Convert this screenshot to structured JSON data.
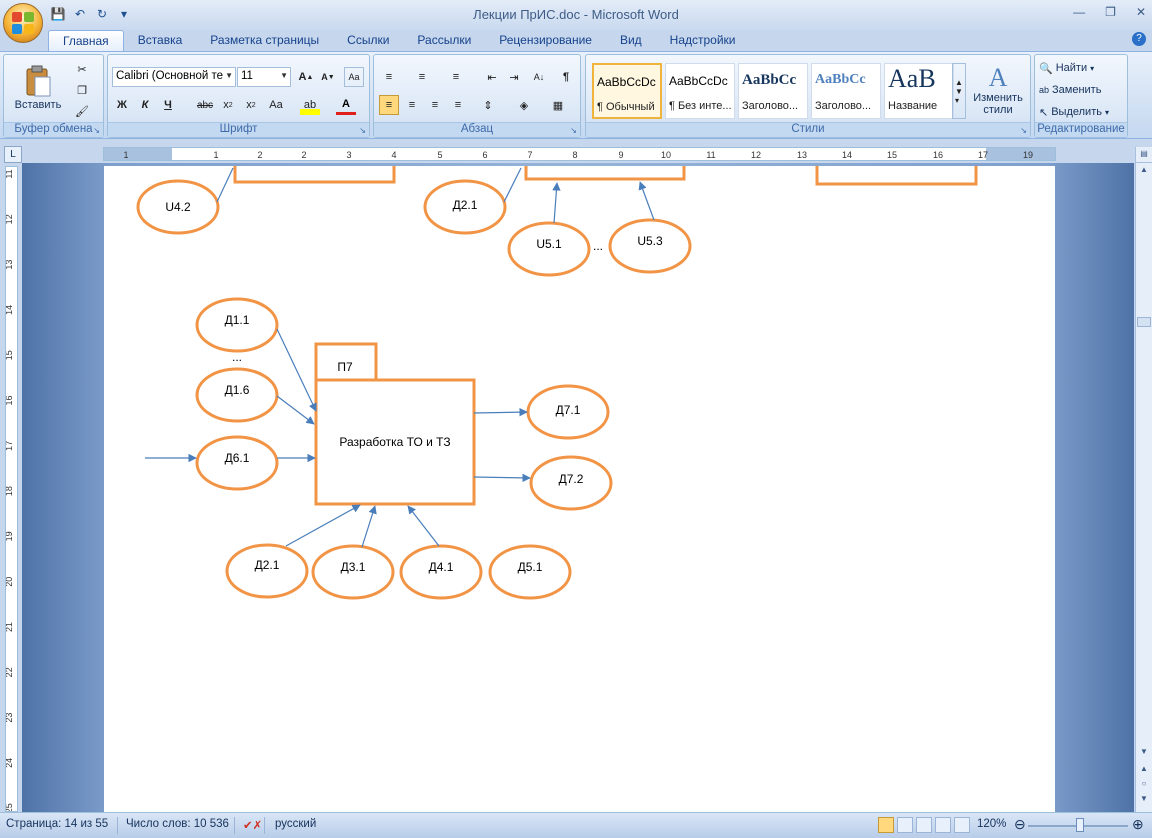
{
  "window": {
    "title": "Лекции ПрИС.doc - Microsoft Word"
  },
  "tabs": [
    "Главная",
    "Вставка",
    "Разметка страницы",
    "Ссылки",
    "Рассылки",
    "Рецензирование",
    "Вид",
    "Надстройки"
  ],
  "ribbon": {
    "clipboard": {
      "label": "Буфер обмена",
      "paste": "Вставить"
    },
    "font": {
      "label": "Шрифт",
      "font_name": "Calibri (Основной те",
      "font_size": "11"
    },
    "paragraph": {
      "label": "Абзац"
    },
    "styles": {
      "label": "Стили",
      "items": [
        {
          "sample": "AaBbCcDc",
          "name": "¶ Обычный"
        },
        {
          "sample": "AaBbCcDc",
          "name": "¶ Без инте..."
        },
        {
          "sample": "AaBbCc",
          "name": "Заголово..."
        },
        {
          "sample": "AaBbCc",
          "name": "Заголово..."
        },
        {
          "sample": "AaB",
          "name": "Название"
        }
      ],
      "change": "Изменить стили"
    },
    "editing": {
      "label": "Редактирование",
      "find": "Найти",
      "replace": "Заменить",
      "select": "Выделить"
    }
  },
  "diagram": {
    "top_ellipses": [
      "U4.2",
      "Д2.1",
      "U5.1",
      "U5.3"
    ],
    "top_ellipsis_dots": "...",
    "process_tab": "П7",
    "process_name": "Разработка ТО и ТЗ",
    "inputs_left": [
      "Д1.1",
      "Д1.6",
      "Д6.1"
    ],
    "inputs_dots": "...",
    "outputs": [
      "Д7.1",
      "Д7.2"
    ],
    "inputs_bottom": [
      "Д2.1",
      "Д3.1",
      "Д4.1",
      "Д5.1"
    ]
  },
  "ruler": {
    "h_ticks": [
      "1",
      "2",
      "1",
      "2",
      "3",
      "4",
      "5",
      "6",
      "7",
      "8",
      "9",
      "10",
      "11",
      "12",
      "13",
      "14",
      "15",
      "16",
      "17",
      "19"
    ],
    "v_ticks": [
      "11",
      "12",
      "13",
      "14",
      "15",
      "16",
      "17",
      "18",
      "19",
      "20",
      "21",
      "22",
      "23",
      "24",
      "25"
    ]
  },
  "status": {
    "page": "Страница: 14 из 55",
    "words": "Число слов: 10 536",
    "language": "русский",
    "zoom": "120%"
  },
  "colors": {
    "shape_stroke": "#f29446",
    "arrow": "#4a7ebb"
  }
}
